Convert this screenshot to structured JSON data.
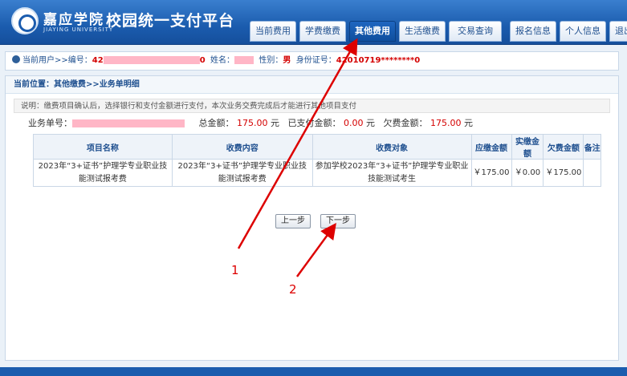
{
  "header": {
    "school_name": "嘉应学院",
    "school_en": "JIAYING UNIVERSITY",
    "platform_name": "校园统一支付平台",
    "nav": [
      {
        "label": "当前费用"
      },
      {
        "label": "学费缴费"
      },
      {
        "label": "其他费用",
        "active": true
      },
      {
        "label": "生活缴费"
      },
      {
        "label": "交易查询"
      },
      {
        "label": "报名信息"
      },
      {
        "label": "个人信息"
      },
      {
        "label": "退出登录"
      }
    ]
  },
  "userbar": {
    "prefix": "当前用户>>编号：",
    "id_visible_start": "42",
    "id_visible_end": "0",
    "name_label": "姓名：",
    "gender_label": "性别：",
    "gender_value": "男",
    "idcard_label": "身份证号：",
    "idcard_value_start": "42010719",
    "idcard_value_end": "********0"
  },
  "breadcrumb": "当前位置：其他缴费>>业务单明细",
  "notice": "说明：缴费项目确认后，选择银行和支付金额进行支付，本次业务交费完成后才能进行其他项目支付",
  "summary": {
    "order_label": "业务单号：",
    "total_label": "总金额：",
    "total_value": "175.00",
    "paid_label": "已支付金额：",
    "paid_value": "0.00",
    "owed_label": "欠费金额：",
    "owed_value": "175.00",
    "unit": "元"
  },
  "table": {
    "headers": [
      "项目名称",
      "收费内容",
      "收费对象",
      "应缴金额",
      "实缴金额",
      "欠费金额",
      "备注"
    ],
    "rows": [
      {
        "item": "2023年“3+证书”护理学专业职业技能测试报考费",
        "content": "2023年“3+证书”护理学专业职业技能测试报考费",
        "target": "参加学校2023年“3+证书”护理学专业职业技能测试考生",
        "due": "￥175.00",
        "paid": "￥0.00",
        "owed": "￥175.00",
        "remark": ""
      }
    ]
  },
  "buttons": {
    "prev": "上一步",
    "next": "下一步"
  },
  "annotations": {
    "label_1": "1",
    "label_2": "2"
  },
  "colors": {
    "accent": "#1b5cae",
    "amount_red": "#d40000",
    "annotation": "#dd0000"
  }
}
